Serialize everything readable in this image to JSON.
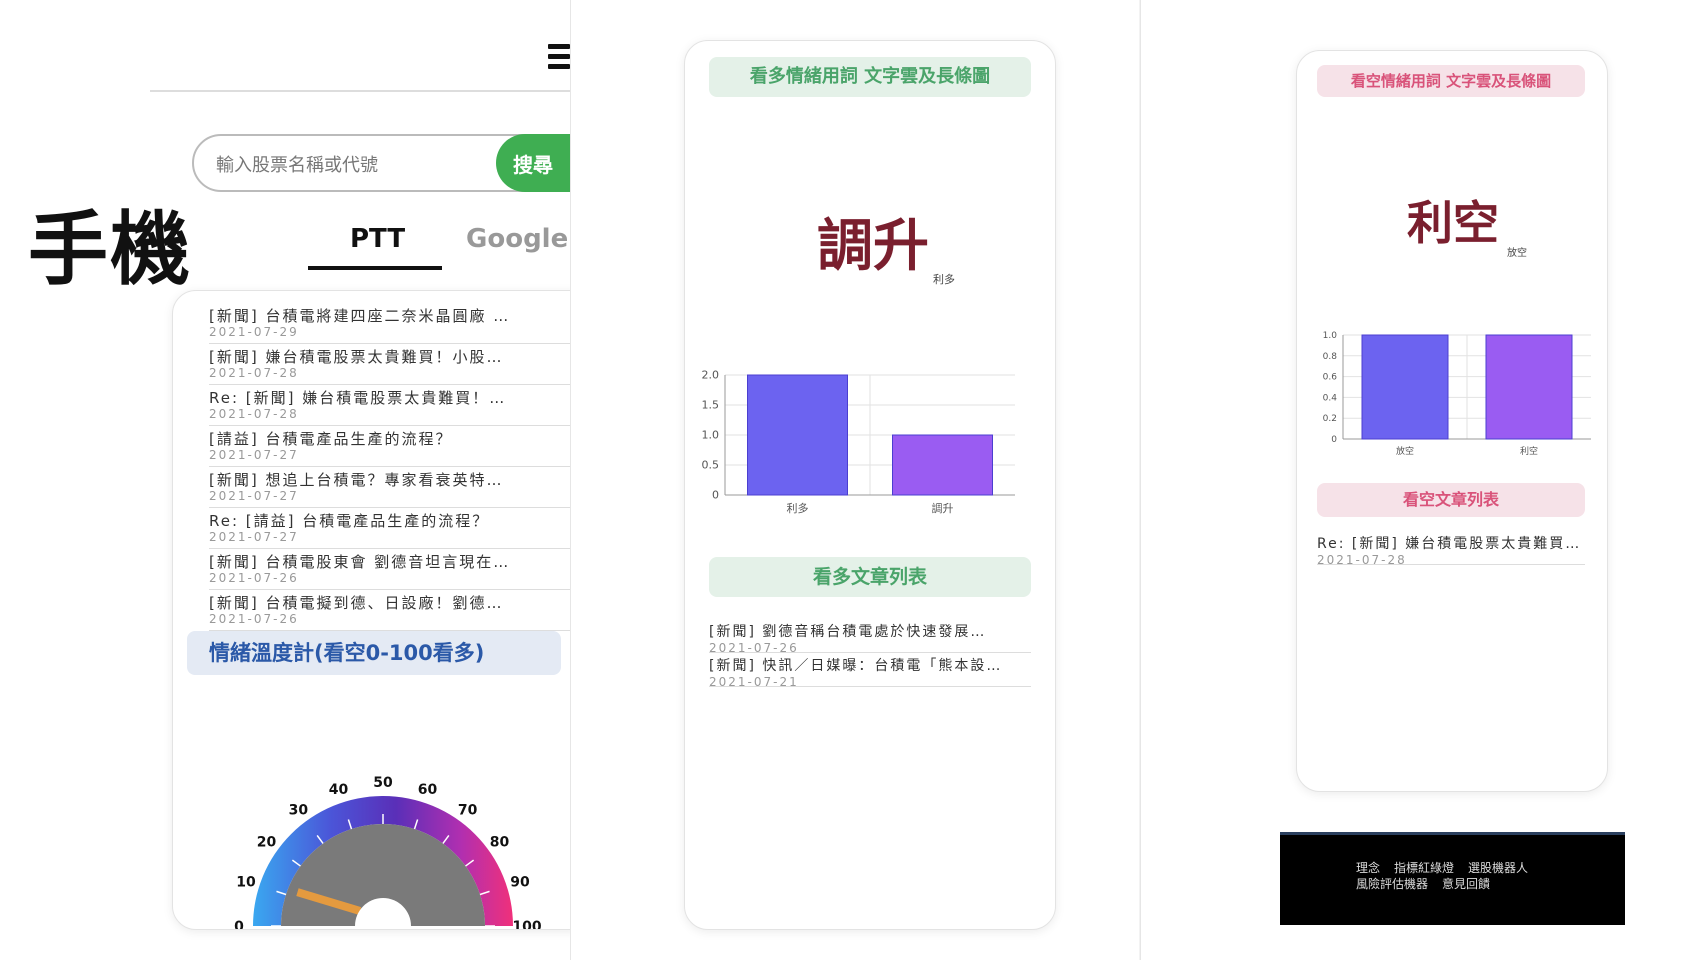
{
  "mobile_label": "手機",
  "search": {
    "placeholder": "輸入股票名稱或代號",
    "button_label": "搜尋"
  },
  "tabs": [
    {
      "label": "PTT"
    },
    {
      "label": "Google"
    }
  ],
  "ptt_articles": [
    {
      "title": "[新聞] 台積電將建四座二奈米晶圓廠 …",
      "date": "2021-07-29"
    },
    {
      "title": "[新聞] 嫌台積電股票太貴難買！小股…",
      "date": "2021-07-28"
    },
    {
      "title": "Re: [新聞] 嫌台積電股票太貴難買！…",
      "date": "2021-07-28"
    },
    {
      "title": "[請益] 台積電產品生產的流程？",
      "date": "2021-07-27"
    },
    {
      "title": "[新聞] 想追上台積電？專家看衰英特…",
      "date": "2021-07-27"
    },
    {
      "title": "Re: [請益] 台積電產品生產的流程？",
      "date": "2021-07-27"
    },
    {
      "title": "[新聞] 台積電股東會 劉德音坦言現在…",
      "date": "2021-07-26"
    },
    {
      "title": "[新聞] 台積電擬到德、日設廠！劉德…",
      "date": "2021-07-26"
    }
  ],
  "gauge": {
    "title": "情緒溫度計(看空0-100看多)",
    "min": 0,
    "max": 100,
    "ticks": [
      "0",
      "10",
      "20",
      "30",
      "40",
      "50",
      "60",
      "70",
      "80",
      "90",
      "100"
    ],
    "value": 12
  },
  "bull": {
    "heading": "看多情緒用詞 文字雲及長條圖",
    "cloud_main": "調升",
    "cloud_small": "利多",
    "list_heading": "看多文章列表",
    "articles": [
      {
        "title": "[新聞] 劉德音稱台積電處於快速發展…",
        "date": "2021-07-26"
      },
      {
        "title": "[新聞] 快訊／日媒曝：台積電「熊本設…",
        "date": "2021-07-21"
      }
    ]
  },
  "bear": {
    "heading": "看空情緒用詞 文字雲及長條圖",
    "cloud_main": "利空",
    "cloud_small": "放空",
    "list_heading": "看空文章列表",
    "articles": [
      {
        "title": "Re: [新聞] 嫌台積電股票太貴難買！…",
        "date": "2021-07-28"
      }
    ]
  },
  "chart_data": [
    {
      "type": "bar",
      "categories": [
        "利多",
        "調升"
      ],
      "values": [
        2.0,
        1.0
      ],
      "ylim": [
        0,
        2.0
      ],
      "yticks": [
        "0",
        "0.5",
        "1.0",
        "1.5",
        "2.0"
      ],
      "colors": [
        "#6c63f0",
        "#9a5cf2"
      ],
      "grid": true
    },
    {
      "type": "bar",
      "categories": [
        "放空",
        "利空"
      ],
      "values": [
        1.0,
        1.0
      ],
      "ylim": [
        0,
        1.0
      ],
      "yticks": [
        "0",
        "0.2",
        "0.4",
        "0.6",
        "0.8",
        "1.0"
      ],
      "colors": [
        "#6c63f0",
        "#9a5cf2"
      ],
      "grid": true
    }
  ],
  "footer": {
    "row1": [
      "理念",
      "指標紅綠燈",
      "選股機器人"
    ],
    "row2": [
      "風險評估機器",
      "意見回饋"
    ]
  }
}
